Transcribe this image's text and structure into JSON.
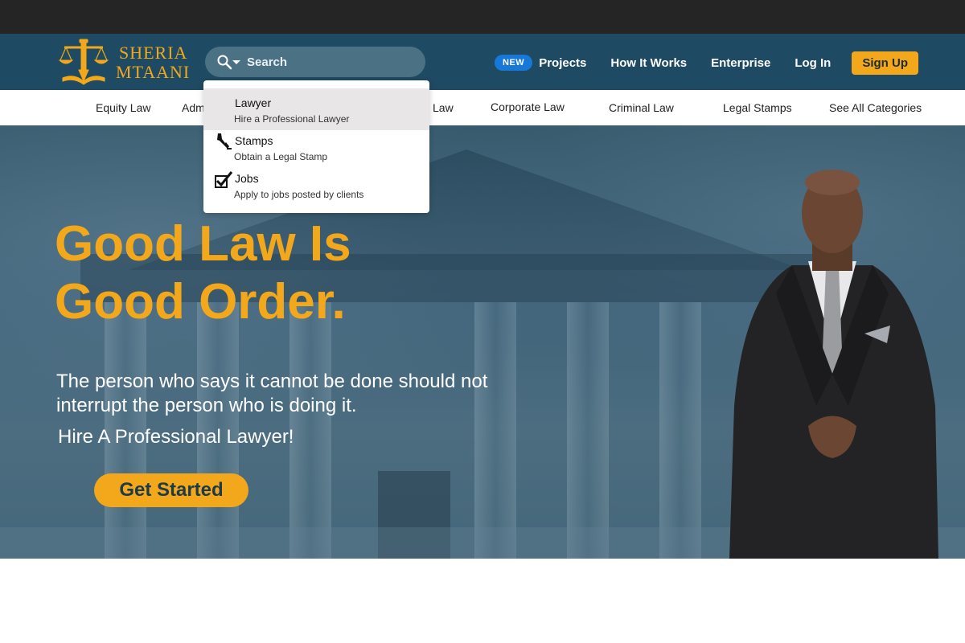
{
  "brand": {
    "line1": "SHERIA",
    "line2": "MTAANI"
  },
  "search": {
    "placeholder": "Search"
  },
  "nav": {
    "badge": "NEW",
    "projects": "Projects",
    "how_it_works": "How It Works",
    "enterprise": "Enterprise",
    "login": "Log In",
    "signup": "Sign Up"
  },
  "categories": [
    "Equity Law",
    "Adm",
    "Law",
    "Corporate Law",
    "Criminal Law",
    "Legal Stamps",
    "See All Categories"
  ],
  "dropdown": {
    "items": [
      {
        "title": "Lawyer",
        "subtitle": "Hire a Professional Lawyer",
        "icon": "none"
      },
      {
        "title": "Stamps",
        "subtitle": "Obtain a Legal Stamp",
        "icon": "stamp-icon"
      },
      {
        "title": "Jobs",
        "subtitle": "Apply to jobs posted by clients",
        "icon": "checkbox-icon"
      }
    ]
  },
  "hero": {
    "headline_line1": "Good Law Is",
    "headline_line2": "Good Order.",
    "quote": "The person who says it cannot be done should not interrupt the person who is doing it.",
    "subline": "Hire A Professional Lawyer!",
    "cta": "Get Started"
  },
  "colors": {
    "accent": "#f2a81a",
    "header": "#1f4a63",
    "topbar": "#252525",
    "badge": "#1778d8"
  }
}
